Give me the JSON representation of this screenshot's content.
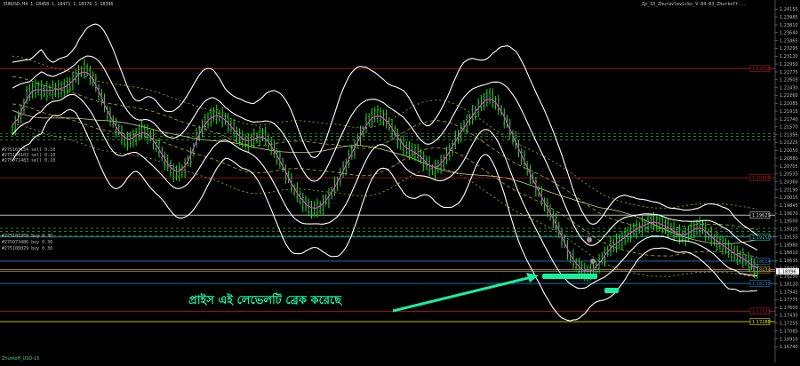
{
  "header": {
    "symbol_info": "EURUSD,H4  1.18468  1.18471  1.18376  1.18396",
    "indicator": "Zp_33_Zhuravlevicko_V-04-03_Zhurkoff..."
  },
  "orders": [
    {
      "label": "#275103154 sell 0.10",
      "price": 1.2142
    },
    {
      "label": "#275104103 sell 0.10",
      "price": 1.2136
    },
    {
      "label": "#275071483 sell 0.10",
      "price": 1.2128
    },
    {
      "label": "#275103256 buy 0.30",
      "price": 1.1934
    },
    {
      "label": "#275073486 buy 0.30",
      "price": 1.1927
    },
    {
      "label": "#275108029 buy 0.30",
      "price": 1.1918
    }
  ],
  "annotation": {
    "text": "প্রাইস এই লেভেলটি ব্রেক করেছে",
    "color": "#18f0a0"
  },
  "footer": "Zhurkoff_USD-15",
  "colors": {
    "background": "#000000",
    "price_bars": "#22dd22",
    "bollinger": "#ffffff",
    "ma": "#ff30ff",
    "envelope": "#b8b020",
    "annotation": "#18f0a0",
    "current_price_box": "#ffffff"
  },
  "chart_data": {
    "type": "line",
    "ylim": [
      1.1655,
      1.242
    ],
    "price_ticks": [
      "1.24155",
      "1.23985",
      "1.23810",
      "1.23640",
      "1.23465",
      "1.23295",
      "1.23120",
      "1.22950",
      "1.22775",
      "1.22605",
      "1.22430",
      "1.22260",
      "1.22085",
      "1.21915",
      "1.21740",
      "1.21570",
      "1.21395",
      "1.21225",
      "1.21050",
      "1.20880",
      "1.20705",
      "1.20535",
      "1.20360",
      "1.20190",
      "1.20015",
      "1.19845",
      "1.19670",
      "1.19500",
      "1.19325",
      "1.19155",
      "1.18980",
      "1.18810",
      "1.18635",
      "1.18465",
      "1.18290",
      "1.18120",
      "1.17945",
      "1.17775",
      "1.17600",
      "1.17430",
      "1.17255",
      "1.17085",
      "1.16910",
      "1.16740"
    ],
    "current_price": "1.18396",
    "levels": [
      {
        "price": 1.2285,
        "color": "#b02020",
        "label": "1.22855"
      },
      {
        "price": 1.2045,
        "color": "#b02020",
        "label": "1.20450"
      },
      {
        "price": 1.1963,
        "color": "#d8d8d8",
        "label": "1.19629"
      },
      {
        "price": 1.1915,
        "color": "#20c0c0",
        "label": "1.19150"
      },
      {
        "price": 1.1862,
        "color": "#2080c0",
        "label": "1.18624"
      },
      {
        "price": 1.1843,
        "color": "#e0a020",
        "label": "1.18434"
      },
      {
        "price": 1.1813,
        "color": "#2080c0",
        "label": "1.18130"
      },
      {
        "price": 1.1752,
        "color": "#b02020",
        "label": "1.17524"
      },
      {
        "price": 1.1729,
        "color": "#e0e000",
        "label": "1.17288"
      }
    ],
    "price_series": [
      1.215,
      1.2185,
      1.2232,
      1.2242,
      1.2235,
      1.2238,
      1.224,
      1.2248,
      1.227,
      1.2285,
      1.2262,
      1.2222,
      1.218,
      1.2152,
      1.2125,
      1.2132,
      1.215,
      1.2138,
      1.2112,
      1.208,
      1.2055,
      1.206,
      1.209,
      1.2142,
      1.217,
      1.2185,
      1.2178,
      1.216,
      1.2135,
      1.2122,
      1.2132,
      1.214,
      1.2115,
      1.2085,
      1.2048,
      1.2015,
      1.199,
      1.1975,
      1.198,
      1.2,
      1.203,
      1.2065,
      1.2102,
      1.2138,
      1.2172,
      1.2185,
      1.2176,
      1.2152,
      1.212,
      1.2105,
      1.21,
      1.208,
      1.2062,
      1.2075,
      1.2102,
      1.2135,
      1.2162,
      1.2185,
      1.221,
      1.2225,
      1.2205,
      1.217,
      1.213,
      1.209,
      1.2052,
      1.2015,
      1.198,
      1.195,
      1.191,
      1.187,
      1.1848,
      1.1835,
      1.1845,
      1.187,
      1.1895,
      1.1905,
      1.192,
      1.1932,
      1.194,
      1.195,
      1.1945,
      1.1935,
      1.1925,
      1.1915,
      1.193,
      1.194,
      1.192,
      1.1905,
      1.1895,
      1.188,
      1.187,
      1.186,
      1.184
    ]
  }
}
